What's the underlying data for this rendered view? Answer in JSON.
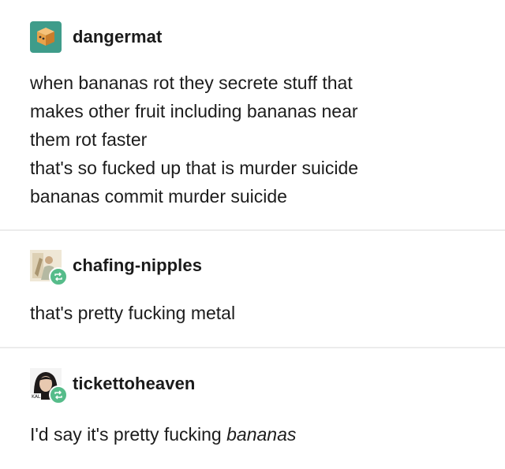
{
  "posts": [
    {
      "username": "dangermat",
      "avatar_icon": "box-face-icon",
      "lines": [
        "when bananas rot they secrete stuff that",
        "makes other fruit including bananas near",
        "them rot faster",
        "that's so fucked up that is murder suicide",
        "bananas commit murder suicide"
      ]
    },
    {
      "username": "chafing-nipples",
      "avatar_icon": "sketch-avatar-icon",
      "reblog_icon": "reblog-icon",
      "lines": [
        "that's pretty fucking metal"
      ]
    },
    {
      "username": "tickettoheaven",
      "avatar_icon": "cartoon-girl-avatar-icon",
      "reblog_icon": "reblog-icon",
      "text_prefix": "I'd say it's pretty fucking ",
      "text_italic": "bananas"
    }
  ],
  "colors": {
    "badge_green": "#56bc8a",
    "divider": "#ececec",
    "avatar_teal": "#3f9c8a",
    "avatar_box": "#e9a24a"
  }
}
